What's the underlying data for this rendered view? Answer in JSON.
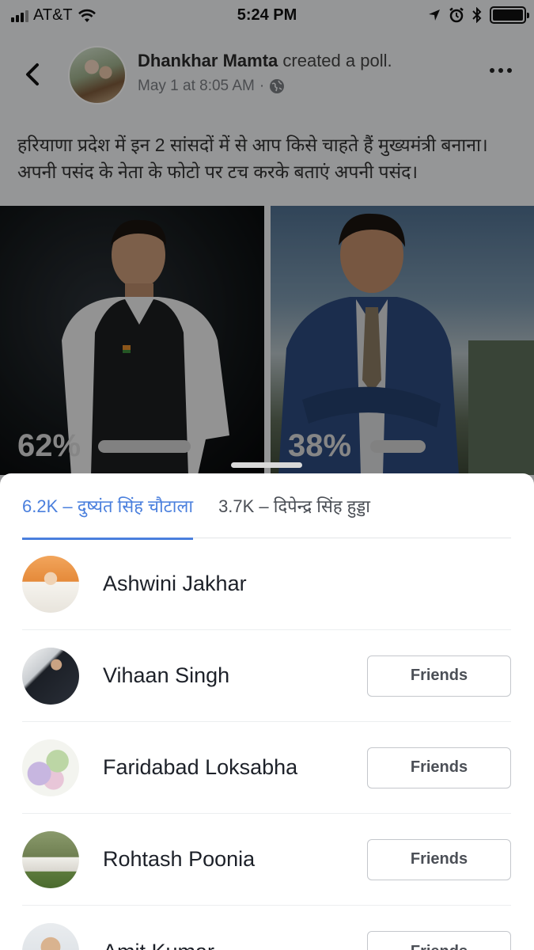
{
  "status_bar": {
    "carrier": "AT&T",
    "time": "5:24 PM"
  },
  "post": {
    "author": "Dhankhar Mamta",
    "action": " created a poll.",
    "timestamp": "May 1 at 8:05 AM",
    "separator": "·",
    "privacy_icon": "globe-icon",
    "text": "हरियाणा प्रदेश में इन 2 सांसदों में से आप किसे चाहते हैं मुख्यमंत्री बनाना। अपनी पसंद के नेता के फोटो पर टच करके बताएं अपनी पसंद।"
  },
  "poll": {
    "options": [
      {
        "percent_label": "62%",
        "percent": 62
      },
      {
        "percent_label": "38%",
        "percent": 38
      }
    ]
  },
  "sheet": {
    "tabs": [
      {
        "label": "6.2K – दुष्यंत सिंह चौटाला",
        "active": true
      },
      {
        "label": "3.7K – दिपेन्द्र सिंह हुड्डा",
        "active": false
      }
    ],
    "voters": [
      {
        "name": "Ashwini Jakhar",
        "button": ""
      },
      {
        "name": "Vihaan Singh",
        "button": "Friends"
      },
      {
        "name": "Faridabad Loksabha",
        "button": "Friends"
      },
      {
        "name": "Rohtash Poonia",
        "button": "Friends"
      },
      {
        "name": "Amit Kumar",
        "button": "Friends"
      }
    ]
  },
  "colors": {
    "accent": "#4a7fdd",
    "dim_overlay": "rgba(0,0,0,0.38)"
  }
}
